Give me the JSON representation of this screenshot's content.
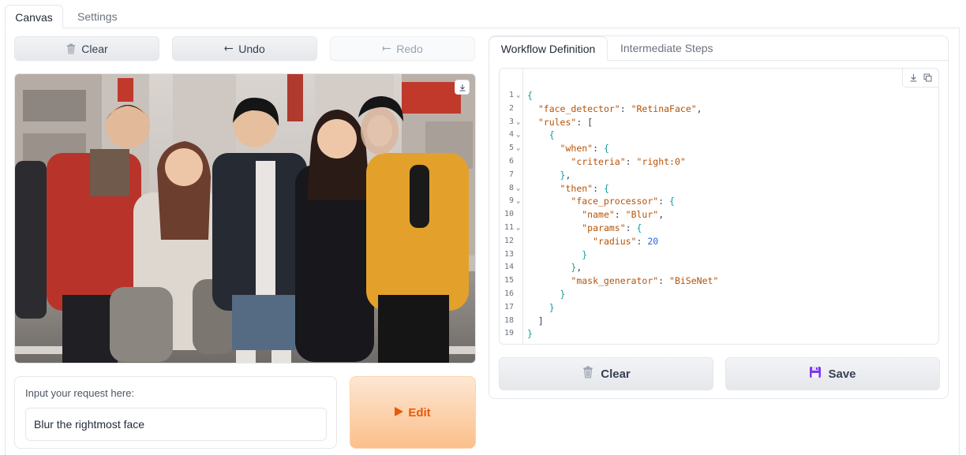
{
  "top_tabs": [
    {
      "label": "Canvas",
      "active": true
    },
    {
      "label": "Settings",
      "active": false
    }
  ],
  "toolbar": {
    "clear_label": "Clear",
    "undo_label": "Undo",
    "redo_label": "Redo"
  },
  "image": {
    "description_icon": "download-icon"
  },
  "request": {
    "label": "Input your request here:",
    "value": "Blur the rightmost face"
  },
  "edit_button": {
    "label": "Edit"
  },
  "right_tabs": [
    {
      "label": "Workflow Definition",
      "active": true
    },
    {
      "label": "Intermediate Steps",
      "active": false
    }
  ],
  "code": {
    "line_numbers": [
      "1",
      "2",
      "3",
      "4",
      "5",
      "6",
      "7",
      "8",
      "9",
      "10",
      "11",
      "12",
      "13",
      "14",
      "15",
      "16",
      "17",
      "18",
      "19"
    ],
    "folds": [
      1,
      3,
      4,
      5,
      8,
      9,
      11
    ],
    "lines": [
      [
        [
          "p",
          "{"
        ]
      ],
      [
        [
          "o",
          "  "
        ],
        [
          "k",
          "\"face_detector\""
        ],
        [
          "o",
          ": "
        ],
        [
          "s",
          "\"RetinaFace\""
        ],
        [
          "o",
          ","
        ]
      ],
      [
        [
          "o",
          "  "
        ],
        [
          "k",
          "\"rules\""
        ],
        [
          "o",
          ": ["
        ]
      ],
      [
        [
          "o",
          "    "
        ],
        [
          "p",
          "{"
        ]
      ],
      [
        [
          "o",
          "      "
        ],
        [
          "k",
          "\"when\""
        ],
        [
          "o",
          ": "
        ],
        [
          "p",
          "{"
        ]
      ],
      [
        [
          "o",
          "        "
        ],
        [
          "k",
          "\"criteria\""
        ],
        [
          "o",
          ": "
        ],
        [
          "s",
          "\"right:0\""
        ]
      ],
      [
        [
          "o",
          "      "
        ],
        [
          "p",
          "}"
        ],
        [
          "o",
          ","
        ]
      ],
      [
        [
          "o",
          "      "
        ],
        [
          "k",
          "\"then\""
        ],
        [
          "o",
          ": "
        ],
        [
          "p",
          "{"
        ]
      ],
      [
        [
          "o",
          "        "
        ],
        [
          "k",
          "\"face_processor\""
        ],
        [
          "o",
          ": "
        ],
        [
          "p",
          "{"
        ]
      ],
      [
        [
          "o",
          "          "
        ],
        [
          "k",
          "\"name\""
        ],
        [
          "o",
          ": "
        ],
        [
          "s",
          "\"Blur\""
        ],
        [
          "o",
          ","
        ]
      ],
      [
        [
          "o",
          "          "
        ],
        [
          "k",
          "\"params\""
        ],
        [
          "o",
          ": "
        ],
        [
          "p",
          "{"
        ]
      ],
      [
        [
          "o",
          "            "
        ],
        [
          "k",
          "\"radius\""
        ],
        [
          "o",
          ": "
        ],
        [
          "n",
          "20"
        ]
      ],
      [
        [
          "o",
          "          "
        ],
        [
          "p",
          "}"
        ]
      ],
      [
        [
          "o",
          "        "
        ],
        [
          "p",
          "}"
        ],
        [
          "o",
          ","
        ]
      ],
      [
        [
          "o",
          "        "
        ],
        [
          "k",
          "\"mask_generator\""
        ],
        [
          "o",
          ": "
        ],
        [
          "s",
          "\"BiSeNet\""
        ]
      ],
      [
        [
          "o",
          "      "
        ],
        [
          "p",
          "}"
        ]
      ],
      [
        [
          "o",
          "    "
        ],
        [
          "p",
          "}"
        ]
      ],
      [
        [
          "o",
          "  ]"
        ]
      ],
      [
        [
          "p",
          "}"
        ]
      ]
    ]
  },
  "bottom_buttons": {
    "clear_label": "Clear",
    "save_label": "Save"
  },
  "colors": {
    "accent": "#ea580c",
    "code_key": "#b45309",
    "code_brace": "#0e9f9a",
    "code_number": "#2563eb"
  }
}
